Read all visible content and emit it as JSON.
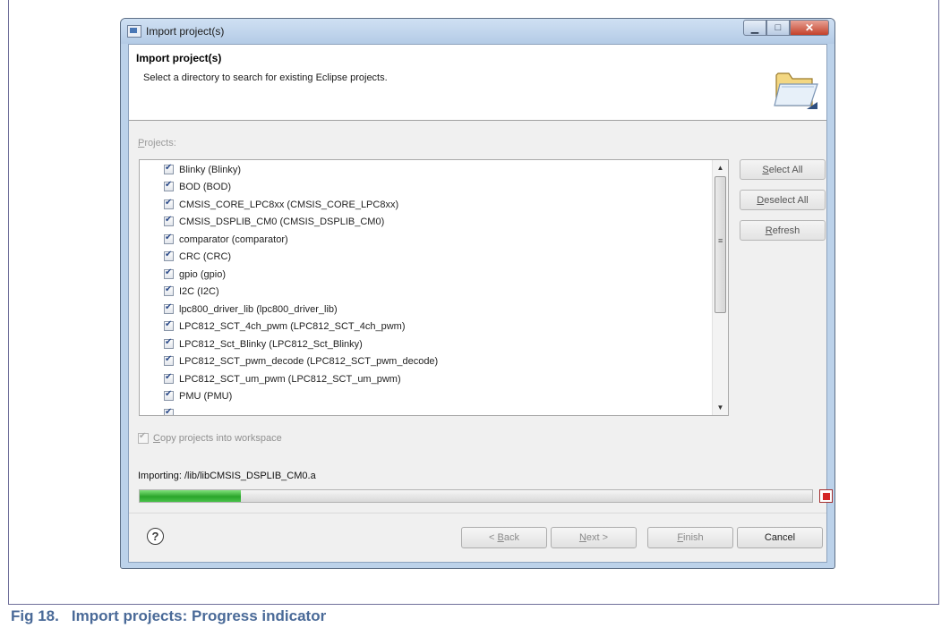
{
  "dialog": {
    "window_title": "Import project(s)",
    "header_title": "Import project(s)",
    "header_subtitle": "Select a directory to search for existing Eclipse projects.",
    "projects_label_mnemonic": "P",
    "projects_label_rest": "rojects:",
    "projects": [
      "Blinky (Blinky)",
      "BOD (BOD)",
      "CMSIS_CORE_LPC8xx (CMSIS_CORE_LPC8xx)",
      "CMSIS_DSPLIB_CM0 (CMSIS_DSPLIB_CM0)",
      "comparator (comparator)",
      "CRC (CRC)",
      "gpio (gpio)",
      "I2C (I2C)",
      "lpc800_driver_lib (lpc800_driver_lib)",
      "LPC812_SCT_4ch_pwm (LPC812_SCT_4ch_pwm)",
      "LPC812_Sct_Blinky (LPC812_Sct_Blinky)",
      "LPC812_SCT_pwm_decode (LPC812_SCT_pwm_decode)",
      "LPC812_SCT_um_pwm (LPC812_SCT_um_pwm)",
      "PMU (PMU)"
    ],
    "select_all_mnemonic": "S",
    "select_all_rest": "elect All",
    "deselect_all_mnemonic": "D",
    "deselect_all_rest": "eselect All",
    "refresh_mnemonic": "R",
    "refresh_rest": "efresh",
    "copy_option_mnemonic": "C",
    "copy_option_rest": "opy projects into workspace",
    "copy_option_checked": true,
    "importing_text": "Importing: /lib/libCMSIS_DSPLIB_CM0.a",
    "progress_fraction": 0.15,
    "back_prefix": "< ",
    "back_mnemonic": "B",
    "back_rest": "ack",
    "next_mnemonic": "N",
    "next_rest": "ext >",
    "finish_mnemonic": "F",
    "finish_rest": "inish",
    "cancel_label": "Cancel"
  },
  "caption": {
    "number": "Fig 18.",
    "text": "Import projects: Progress indicator"
  },
  "colors": {
    "caption": "#4a6a98",
    "progress": "#2aa52a",
    "stop": "#d42626"
  },
  "icons": {
    "app": "eclipse-import-icon",
    "header": "open-folder-icon",
    "help": "help-circle-icon",
    "stop": "stop-icon"
  }
}
